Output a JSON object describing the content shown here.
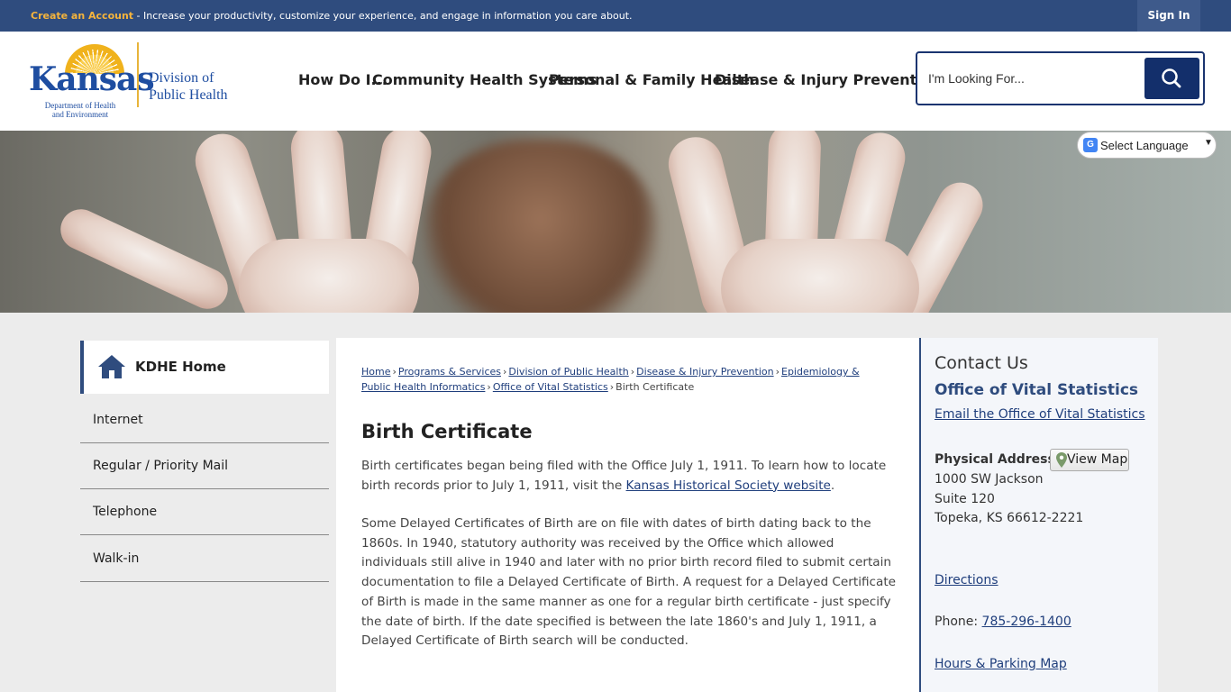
{
  "topbar": {
    "create_account": "Create an Account",
    "message": " - Increase your productivity, customize your experience, and engage in information you care about.",
    "sign_in": "Sign In"
  },
  "logo": {
    "word": "Kansas",
    "dept_line1": "Department of Health",
    "dept_line2": "and Environment",
    "division_line1": "Division of",
    "division_line2": "Public Health"
  },
  "nav": {
    "items": [
      "How Do I...",
      "Community Health Systems",
      "Personal & Family Health",
      "Disease & Injury Prevention"
    ]
  },
  "search": {
    "placeholder": "I'm Looking For..."
  },
  "translate": {
    "label": "Select Language"
  },
  "sidebar": {
    "home_label": "KDHE Home",
    "items": [
      "Internet",
      "Regular / Priority Mail",
      "Telephone",
      "Walk-in"
    ]
  },
  "breadcrumb": {
    "items": [
      "Home",
      "Programs & Services",
      "Division of Public Health",
      "Disease & Injury Prevention",
      "Epidemiology & Public Health Informatics",
      "Office of Vital Statistics"
    ],
    "current": "Birth Certificate"
  },
  "main": {
    "title": "Birth Certificate",
    "p1_text": "Birth certificates began being filed with the Office July 1, 1911. To learn how to locate birth records prior to July 1, 1911, visit the ",
    "p1_link": "Kansas Historical Society website",
    "p1_end": ".",
    "p2": "Some Delayed Certificates of Birth are on file with dates of birth dating back to the 1860s. In 1940, statutory authority was received by the Office which allowed individuals still alive in 1940 and later with no prior birth record filed to submit certain documentation to file a Delayed Certificate of Birth. A request for a Delayed Certificate of Birth is made in the same manner as one for a regular birth certificate - just specify the date of birth. If the date specified is between the late 1860's and July 1, 1911, a Delayed Certificate of Birth search will be conducted."
  },
  "contact": {
    "heading": "Contact Us",
    "department": "Office of Vital Statistics",
    "email_link": "Email the Office of Vital Statistics",
    "address_label": "Physical Address",
    "view_map": "View Map",
    "address_line1": "1000 SW Jackson",
    "address_line2": "Suite 120",
    "address_line3": "Topeka, KS 66612-2221",
    "directions": "Directions",
    "phone_label": "Phone: ",
    "phone": "785-296-1400",
    "hours": "Hours & Parking Map"
  }
}
